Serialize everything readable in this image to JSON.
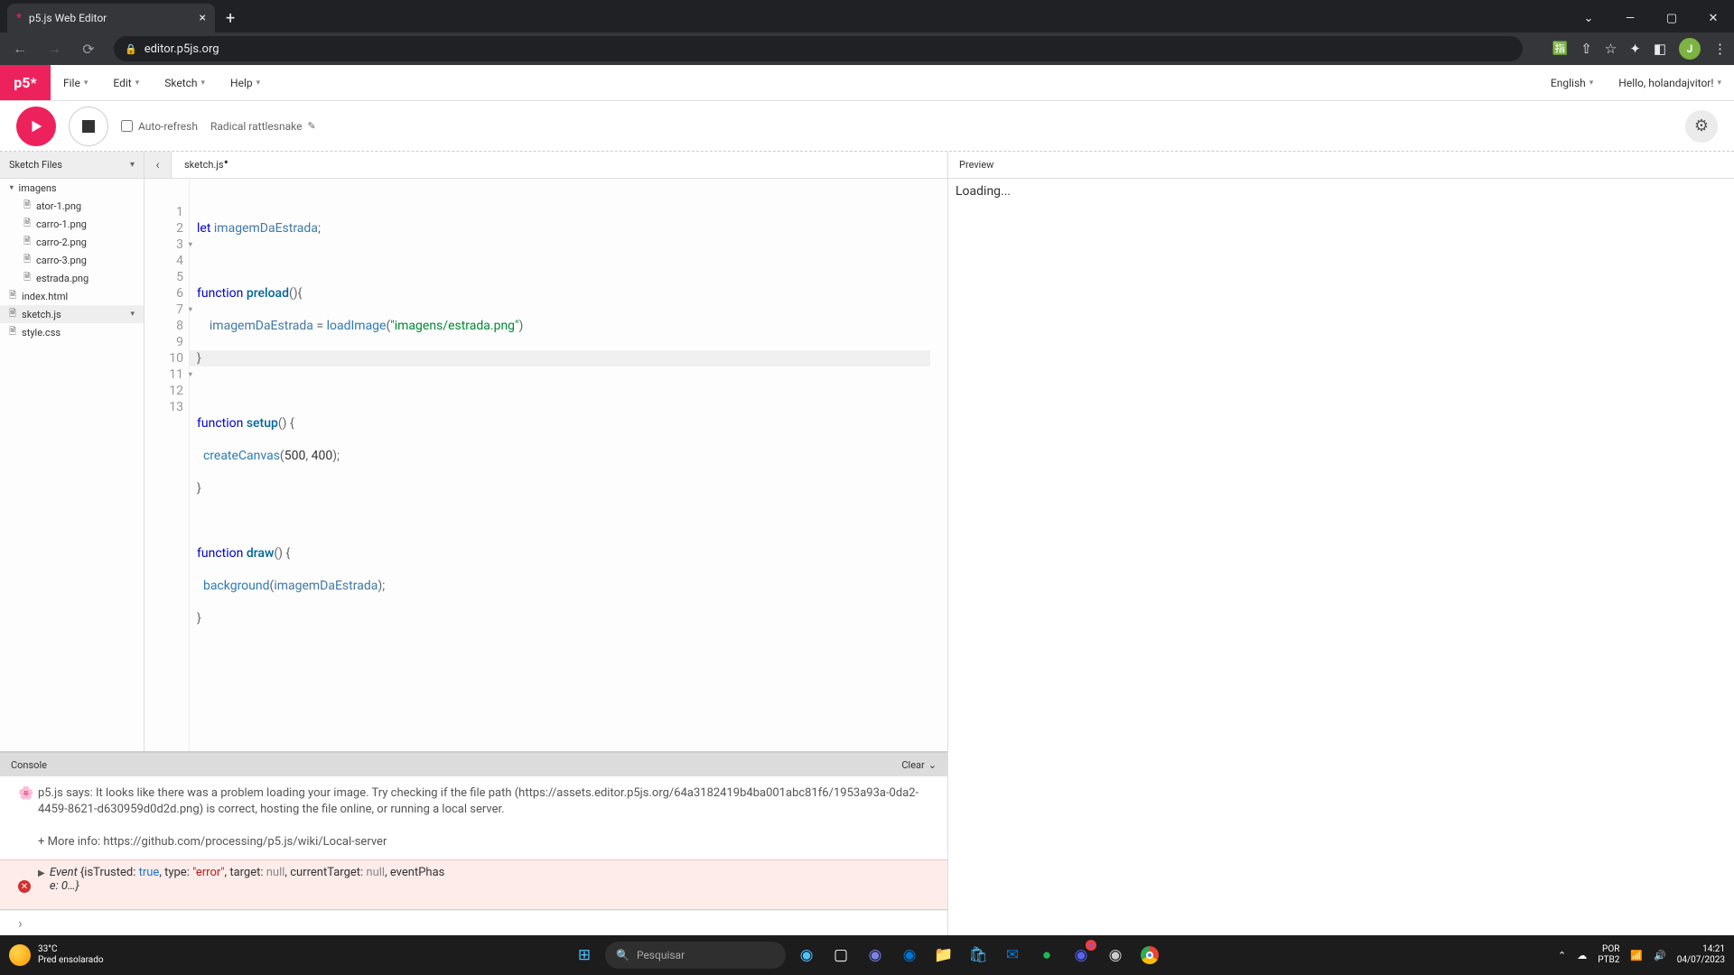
{
  "browser": {
    "tab_title": "p5.js Web Editor",
    "url": "editor.p5js.org",
    "avatar_letter": "J"
  },
  "app": {
    "logo": "p5*",
    "menus": [
      "File",
      "Edit",
      "Sketch",
      "Help"
    ],
    "language": "English",
    "greeting": "Hello, holandajvitor!"
  },
  "toolbar": {
    "auto_refresh_label": "Auto-refresh",
    "auto_refresh_checked": false,
    "sketch_name": "Radical rattlesnake"
  },
  "sidebar": {
    "header": "Sketch Files",
    "items": [
      {
        "label": "imagens",
        "type": "folder",
        "indent": false
      },
      {
        "label": "ator-1.png",
        "type": "file",
        "indent": true
      },
      {
        "label": "carro-1.png",
        "type": "file",
        "indent": true
      },
      {
        "label": "carro-2.png",
        "type": "file",
        "indent": true
      },
      {
        "label": "carro-3.png",
        "type": "file",
        "indent": true
      },
      {
        "label": "estrada.png",
        "type": "file",
        "indent": true
      },
      {
        "label": "index.html",
        "type": "file",
        "indent": false
      },
      {
        "label": "sketch.js",
        "type": "file",
        "indent": false,
        "active": true
      },
      {
        "label": "style.css",
        "type": "file",
        "indent": false
      }
    ]
  },
  "editor_tab": {
    "filename": "sketch.js",
    "dirty": true
  },
  "code": {
    "line_count": 13,
    "active_line": 5,
    "fold_lines": [
      3,
      7,
      11
    ]
  },
  "preview": {
    "header": "Preview",
    "body": "Loading..."
  },
  "console": {
    "header": "Console",
    "clear": "Clear",
    "message": "p5.js says: It looks like there was a problem loading your image. Try checking if the file path (https://assets.editor.p5js.org/64a3182419b4ba001abc81f6/1953a93a-0da2-4459-8621-d630959d0d2d.png) is correct, hosting the file online, or running a local server.",
    "more_info": "+ More info: https://github.com/processing/p5.js/wiki/Local-server",
    "error_event": "Event {isTrusted: true, type: \"error\", target: null, currentTarget: null, eventPhase: 0…}"
  },
  "taskbar": {
    "temp": "33°C",
    "weather_desc": "Pred ensolarado",
    "search_placeholder": "Pesquisar",
    "lang1": "POR",
    "lang2": "PTB2",
    "time": "14:21",
    "date": "04/07/2023"
  }
}
